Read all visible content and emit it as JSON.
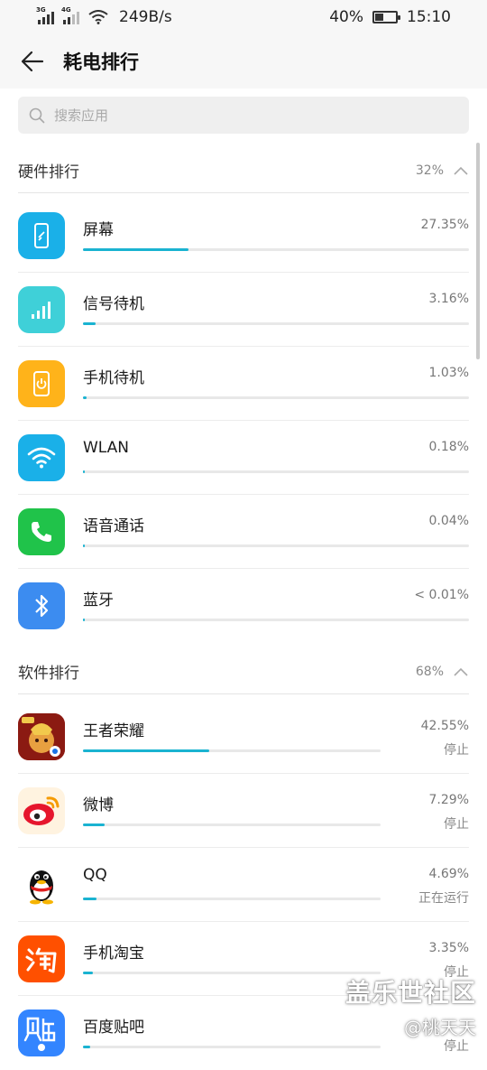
{
  "status_bar": {
    "net1": "3G",
    "net2": "4G",
    "speed": "249B/s",
    "battery_pct": "40%",
    "battery_level": 0.4,
    "time": "15:10"
  },
  "appbar": {
    "title": "耗电排行",
    "back_icon": "arrow-left-icon"
  },
  "search": {
    "placeholder": "搜索应用"
  },
  "hardware": {
    "title": "硬件排行",
    "percent": "32%",
    "items": [
      {
        "name": "屏幕",
        "percent": "27.35%",
        "level": 0.2735,
        "icon": "screen-icon",
        "color": "#1ab0e8"
      },
      {
        "name": "信号待机",
        "percent": "3.16%",
        "level": 0.0316,
        "icon": "signal-icon",
        "color": "#3fd0d8"
      },
      {
        "name": "手机待机",
        "percent": "1.03%",
        "level": 0.0103,
        "icon": "phone-standby-icon",
        "color": "#ffb31a"
      },
      {
        "name": "WLAN",
        "percent": "0.18%",
        "level": 0.0018,
        "icon": "wifi-icon",
        "color": "#1ab0e8"
      },
      {
        "name": "语音通话",
        "percent": "0.04%",
        "level": 0.0004,
        "icon": "phone-call-icon",
        "color": "#20c34a"
      },
      {
        "name": "蓝牙",
        "percent": "< 0.01%",
        "level": 0.0001,
        "icon": "bluetooth-icon",
        "color": "#3c8cf0"
      }
    ]
  },
  "software": {
    "title": "软件排行",
    "percent": "68%",
    "items": [
      {
        "name": "王者荣耀",
        "percent": "42.55%",
        "status": "停止",
        "level": 0.4255,
        "icon": "game-icon"
      },
      {
        "name": "微博",
        "percent": "7.29%",
        "status": "停止",
        "level": 0.0729,
        "icon": "weibo-icon"
      },
      {
        "name": "QQ",
        "percent": "4.69%",
        "status": "正在运行",
        "level": 0.0469,
        "icon": "qq-penguin-icon"
      },
      {
        "name": "手机淘宝",
        "percent": "3.35%",
        "status": "停止",
        "level": 0.0335,
        "icon": "taobao-icon"
      },
      {
        "name": "百度贴吧",
        "percent": "",
        "status": "停止",
        "level": 0.025,
        "icon": "tieba-icon"
      }
    ]
  },
  "watermark": {
    "line1": "盖乐世社区",
    "line2": "@桃天天"
  }
}
